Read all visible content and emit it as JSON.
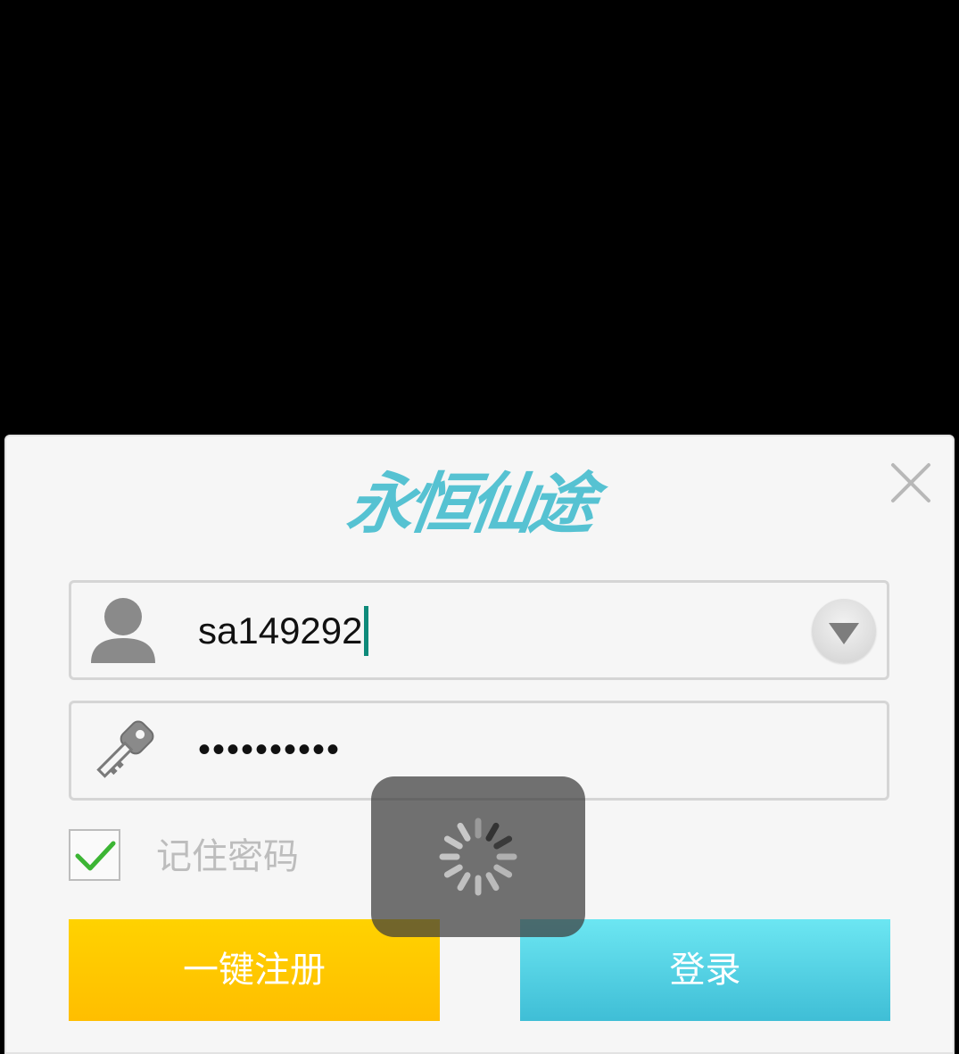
{
  "dialog": {
    "logo_text": "永恒仙途",
    "username": {
      "value": "sa149292"
    },
    "password": {
      "masked_value": "••••••••••"
    },
    "remember": {
      "label": "记住密码",
      "checked": true
    },
    "buttons": {
      "register_label": "一键注册",
      "login_label": "登录"
    }
  },
  "colors": {
    "logo": "#56c2d2",
    "register_button": "#ffc600",
    "login_button": "#4fd0e3",
    "checkmark": "#3cb534",
    "caret": "#0e8a7a"
  },
  "icons": {
    "close": "close-icon",
    "user": "user-icon",
    "key": "key-icon",
    "dropdown": "chevron-down-icon",
    "checkbox": "check-icon",
    "spinner": "spinner-icon"
  }
}
